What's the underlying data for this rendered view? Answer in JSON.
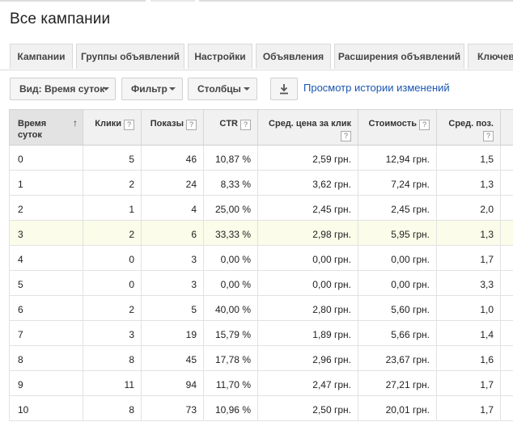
{
  "page": {
    "title": "Все кампании"
  },
  "tabs": [
    {
      "label": "Кампании"
    },
    {
      "label": "Группы объявлений"
    },
    {
      "label": "Настройки"
    },
    {
      "label": "Объявления"
    },
    {
      "label": "Расширения объявлений"
    },
    {
      "label": "Ключевы"
    }
  ],
  "toolbar": {
    "view_label": "Вид: Время суток",
    "filter_label": "Фильтр",
    "columns_label": "Столбцы",
    "history_link": "Просмотр истории изменений"
  },
  "table": {
    "help_glyph": "?",
    "sort_glyph": "↑",
    "headers": {
      "time_line1": "Время",
      "time_line2": "суток",
      "clicks": "Клики",
      "impressions": "Показы",
      "ctr": "CTR",
      "avg_cpc": "Сред. цена за клик",
      "cost": "Стоимость",
      "avg_pos": "Сред. поз."
    },
    "rows": [
      {
        "hour": "0",
        "clicks": "5",
        "impr": "46",
        "ctr": "10,87 %",
        "cpc": "2,59 грн.",
        "cost": "12,94 грн.",
        "pos": "1,5"
      },
      {
        "hour": "1",
        "clicks": "2",
        "impr": "24",
        "ctr": "8,33 %",
        "cpc": "3,62 грн.",
        "cost": "7,24 грн.",
        "pos": "1,3"
      },
      {
        "hour": "2",
        "clicks": "1",
        "impr": "4",
        "ctr": "25,00 %",
        "cpc": "2,45 грн.",
        "cost": "2,45 грн.",
        "pos": "2,0"
      },
      {
        "hour": "3",
        "clicks": "2",
        "impr": "6",
        "ctr": "33,33 %",
        "cpc": "2,98 грн.",
        "cost": "5,95 грн.",
        "pos": "1,3"
      },
      {
        "hour": "4",
        "clicks": "0",
        "impr": "3",
        "ctr": "0,00 %",
        "cpc": "0,00 грн.",
        "cost": "0,00 грн.",
        "pos": "1,7"
      },
      {
        "hour": "5",
        "clicks": "0",
        "impr": "3",
        "ctr": "0,00 %",
        "cpc": "0,00 грн.",
        "cost": "0,00 грн.",
        "pos": "3,3"
      },
      {
        "hour": "6",
        "clicks": "2",
        "impr": "5",
        "ctr": "40,00 %",
        "cpc": "2,80 грн.",
        "cost": "5,60 грн.",
        "pos": "1,0"
      },
      {
        "hour": "7",
        "clicks": "3",
        "impr": "19",
        "ctr": "15,79 %",
        "cpc": "1,89 грн.",
        "cost": "5,66 грн.",
        "pos": "1,4"
      },
      {
        "hour": "8",
        "clicks": "8",
        "impr": "45",
        "ctr": "17,78 %",
        "cpc": "2,96 грн.",
        "cost": "23,67 грн.",
        "pos": "1,6"
      },
      {
        "hour": "9",
        "clicks": "11",
        "impr": "94",
        "ctr": "11,70 %",
        "cpc": "2,47 грн.",
        "cost": "27,21 грн.",
        "pos": "1,7"
      },
      {
        "hour": "10",
        "clicks": "8",
        "impr": "73",
        "ctr": "10,96 %",
        "cpc": "2,50 грн.",
        "cost": "20,01 грн.",
        "pos": "1,7"
      }
    ]
  }
}
